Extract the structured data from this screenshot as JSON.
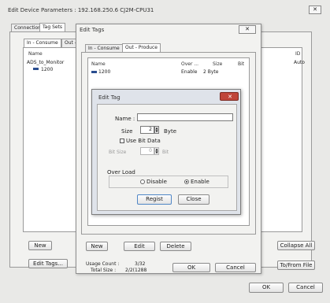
{
  "outer": {
    "title": "Edit Device Parameters : 192.168.250.6 CJ2M-CPU31",
    "close": "✕",
    "tabs": [
      "Connections",
      "Tag Sets"
    ],
    "subtabs": [
      "In - Consume",
      "Out -"
    ],
    "columns": {
      "name": "Name",
      "id": "ID"
    },
    "tree_item": "ADS_to_Monitor",
    "tree_child": "1200",
    "id_value": "Auto",
    "btn_new": "New",
    "btn_edit_tags": "Edit Tags...",
    "btn_collapse_all": "Collapse All",
    "btn_to_from_file": "To/From File",
    "btn_ok": "OK",
    "btn_cancel": "Cancel"
  },
  "edit_tags": {
    "title": "Edit Tags",
    "close": "✕",
    "tabs": [
      "In - Consume",
      "Out - Produce"
    ],
    "columns": {
      "name": "Name",
      "over": "Over ...",
      "size": "Size",
      "bit": "Bit"
    },
    "row": {
      "name": "1200",
      "over": "Enable",
      "size": "2 Byte"
    },
    "btn_new": "New",
    "btn_edit": "Edit",
    "btn_delete": "Delete",
    "usage_label": "Usage Count :",
    "usage_value": "3/32",
    "total_label": "Total Size :",
    "total_value": "2/2(1288",
    "btn_ok": "OK",
    "btn_cancel": "Cancel"
  },
  "edit_tag": {
    "title": "Edit Tag",
    "name_label": "Name :",
    "name_value": "",
    "size_label": "Size",
    "size_value": "2",
    "size_unit": "Byte",
    "use_bit_label": "Use Bit Data",
    "bit_size_label": "Bit Size",
    "bit_size_value": "0",
    "bit_unit": "Bit",
    "over_load_label": "Over Load",
    "disable_label": "Disable",
    "enable_label": "Enable",
    "btn_regist": "Regist",
    "btn_close": "Close"
  }
}
